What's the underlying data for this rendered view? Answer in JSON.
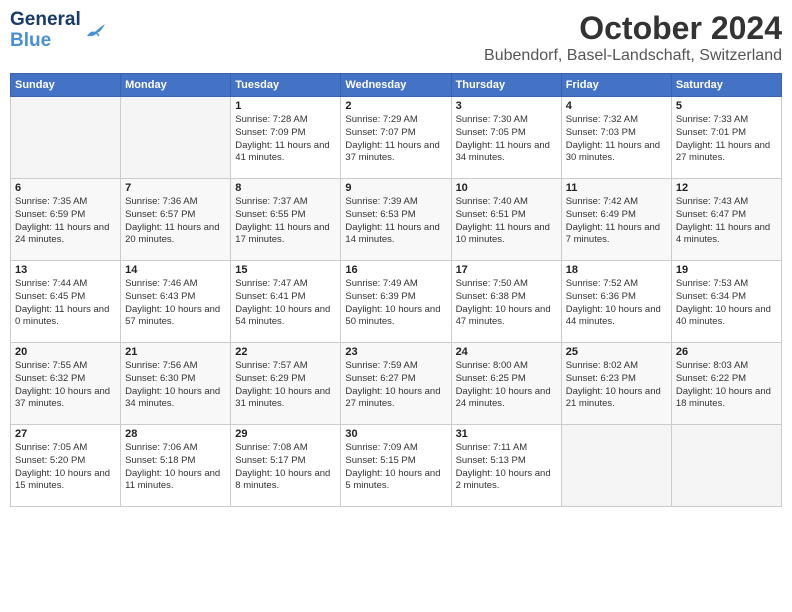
{
  "logo": {
    "line1": "General",
    "line2": "Blue"
  },
  "title": "October 2024",
  "location": "Bubendorf, Basel-Landschaft, Switzerland",
  "days_of_week": [
    "Sunday",
    "Monday",
    "Tuesday",
    "Wednesday",
    "Thursday",
    "Friday",
    "Saturday"
  ],
  "weeks": [
    [
      {
        "day": "",
        "sunrise": "",
        "sunset": "",
        "daylight": ""
      },
      {
        "day": "",
        "sunrise": "",
        "sunset": "",
        "daylight": ""
      },
      {
        "day": "1",
        "sunrise": "Sunrise: 7:28 AM",
        "sunset": "Sunset: 7:09 PM",
        "daylight": "Daylight: 11 hours and 41 minutes."
      },
      {
        "day": "2",
        "sunrise": "Sunrise: 7:29 AM",
        "sunset": "Sunset: 7:07 PM",
        "daylight": "Daylight: 11 hours and 37 minutes."
      },
      {
        "day": "3",
        "sunrise": "Sunrise: 7:30 AM",
        "sunset": "Sunset: 7:05 PM",
        "daylight": "Daylight: 11 hours and 34 minutes."
      },
      {
        "day": "4",
        "sunrise": "Sunrise: 7:32 AM",
        "sunset": "Sunset: 7:03 PM",
        "daylight": "Daylight: 11 hours and 30 minutes."
      },
      {
        "day": "5",
        "sunrise": "Sunrise: 7:33 AM",
        "sunset": "Sunset: 7:01 PM",
        "daylight": "Daylight: 11 hours and 27 minutes."
      }
    ],
    [
      {
        "day": "6",
        "sunrise": "Sunrise: 7:35 AM",
        "sunset": "Sunset: 6:59 PM",
        "daylight": "Daylight: 11 hours and 24 minutes."
      },
      {
        "day": "7",
        "sunrise": "Sunrise: 7:36 AM",
        "sunset": "Sunset: 6:57 PM",
        "daylight": "Daylight: 11 hours and 20 minutes."
      },
      {
        "day": "8",
        "sunrise": "Sunrise: 7:37 AM",
        "sunset": "Sunset: 6:55 PM",
        "daylight": "Daylight: 11 hours and 17 minutes."
      },
      {
        "day": "9",
        "sunrise": "Sunrise: 7:39 AM",
        "sunset": "Sunset: 6:53 PM",
        "daylight": "Daylight: 11 hours and 14 minutes."
      },
      {
        "day": "10",
        "sunrise": "Sunrise: 7:40 AM",
        "sunset": "Sunset: 6:51 PM",
        "daylight": "Daylight: 11 hours and 10 minutes."
      },
      {
        "day": "11",
        "sunrise": "Sunrise: 7:42 AM",
        "sunset": "Sunset: 6:49 PM",
        "daylight": "Daylight: 11 hours and 7 minutes."
      },
      {
        "day": "12",
        "sunrise": "Sunrise: 7:43 AM",
        "sunset": "Sunset: 6:47 PM",
        "daylight": "Daylight: 11 hours and 4 minutes."
      }
    ],
    [
      {
        "day": "13",
        "sunrise": "Sunrise: 7:44 AM",
        "sunset": "Sunset: 6:45 PM",
        "daylight": "Daylight: 11 hours and 0 minutes."
      },
      {
        "day": "14",
        "sunrise": "Sunrise: 7:46 AM",
        "sunset": "Sunset: 6:43 PM",
        "daylight": "Daylight: 10 hours and 57 minutes."
      },
      {
        "day": "15",
        "sunrise": "Sunrise: 7:47 AM",
        "sunset": "Sunset: 6:41 PM",
        "daylight": "Daylight: 10 hours and 54 minutes."
      },
      {
        "day": "16",
        "sunrise": "Sunrise: 7:49 AM",
        "sunset": "Sunset: 6:39 PM",
        "daylight": "Daylight: 10 hours and 50 minutes."
      },
      {
        "day": "17",
        "sunrise": "Sunrise: 7:50 AM",
        "sunset": "Sunset: 6:38 PM",
        "daylight": "Daylight: 10 hours and 47 minutes."
      },
      {
        "day": "18",
        "sunrise": "Sunrise: 7:52 AM",
        "sunset": "Sunset: 6:36 PM",
        "daylight": "Daylight: 10 hours and 44 minutes."
      },
      {
        "day": "19",
        "sunrise": "Sunrise: 7:53 AM",
        "sunset": "Sunset: 6:34 PM",
        "daylight": "Daylight: 10 hours and 40 minutes."
      }
    ],
    [
      {
        "day": "20",
        "sunrise": "Sunrise: 7:55 AM",
        "sunset": "Sunset: 6:32 PM",
        "daylight": "Daylight: 10 hours and 37 minutes."
      },
      {
        "day": "21",
        "sunrise": "Sunrise: 7:56 AM",
        "sunset": "Sunset: 6:30 PM",
        "daylight": "Daylight: 10 hours and 34 minutes."
      },
      {
        "day": "22",
        "sunrise": "Sunrise: 7:57 AM",
        "sunset": "Sunset: 6:29 PM",
        "daylight": "Daylight: 10 hours and 31 minutes."
      },
      {
        "day": "23",
        "sunrise": "Sunrise: 7:59 AM",
        "sunset": "Sunset: 6:27 PM",
        "daylight": "Daylight: 10 hours and 27 minutes."
      },
      {
        "day": "24",
        "sunrise": "Sunrise: 8:00 AM",
        "sunset": "Sunset: 6:25 PM",
        "daylight": "Daylight: 10 hours and 24 minutes."
      },
      {
        "day": "25",
        "sunrise": "Sunrise: 8:02 AM",
        "sunset": "Sunset: 6:23 PM",
        "daylight": "Daylight: 10 hours and 21 minutes."
      },
      {
        "day": "26",
        "sunrise": "Sunrise: 8:03 AM",
        "sunset": "Sunset: 6:22 PM",
        "daylight": "Daylight: 10 hours and 18 minutes."
      }
    ],
    [
      {
        "day": "27",
        "sunrise": "Sunrise: 7:05 AM",
        "sunset": "Sunset: 5:20 PM",
        "daylight": "Daylight: 10 hours and 15 minutes."
      },
      {
        "day": "28",
        "sunrise": "Sunrise: 7:06 AM",
        "sunset": "Sunset: 5:18 PM",
        "daylight": "Daylight: 10 hours and 11 minutes."
      },
      {
        "day": "29",
        "sunrise": "Sunrise: 7:08 AM",
        "sunset": "Sunset: 5:17 PM",
        "daylight": "Daylight: 10 hours and 8 minutes."
      },
      {
        "day": "30",
        "sunrise": "Sunrise: 7:09 AM",
        "sunset": "Sunset: 5:15 PM",
        "daylight": "Daylight: 10 hours and 5 minutes."
      },
      {
        "day": "31",
        "sunrise": "Sunrise: 7:11 AM",
        "sunset": "Sunset: 5:13 PM",
        "daylight": "Daylight: 10 hours and 2 minutes."
      },
      {
        "day": "",
        "sunrise": "",
        "sunset": "",
        "daylight": ""
      },
      {
        "day": "",
        "sunrise": "",
        "sunset": "",
        "daylight": ""
      }
    ]
  ]
}
